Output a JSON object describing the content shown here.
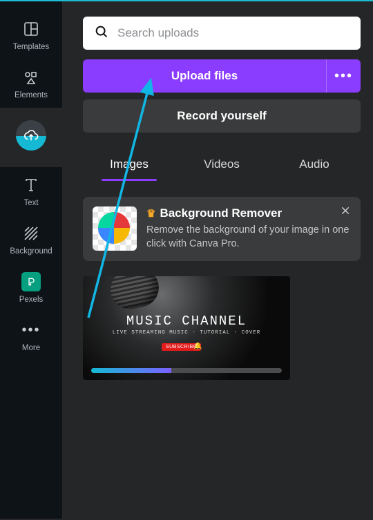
{
  "sidebar": {
    "items": [
      {
        "label": "Templates"
      },
      {
        "label": "Elements"
      },
      {
        "label": "Uploads"
      },
      {
        "label": "Text"
      },
      {
        "label": "Background"
      },
      {
        "label": "Pexels"
      },
      {
        "label": "More"
      }
    ]
  },
  "search": {
    "placeholder": "Search uploads"
  },
  "buttons": {
    "upload": "Upload files",
    "record": "Record yourself"
  },
  "tabs": [
    {
      "label": "Images",
      "active": true
    },
    {
      "label": "Videos",
      "active": false
    },
    {
      "label": "Audio",
      "active": false
    }
  ],
  "promo": {
    "title": "Background Remover",
    "description": "Remove the background of your image in one click with Canva Pro."
  },
  "asset": {
    "headline": "MUSIC CHANNEL",
    "subline": "LIVE STREAMING MUSIC - TUTORIAL - COVER",
    "badge": "SUBSCRIBE",
    "upload_progress_pct": 42
  }
}
